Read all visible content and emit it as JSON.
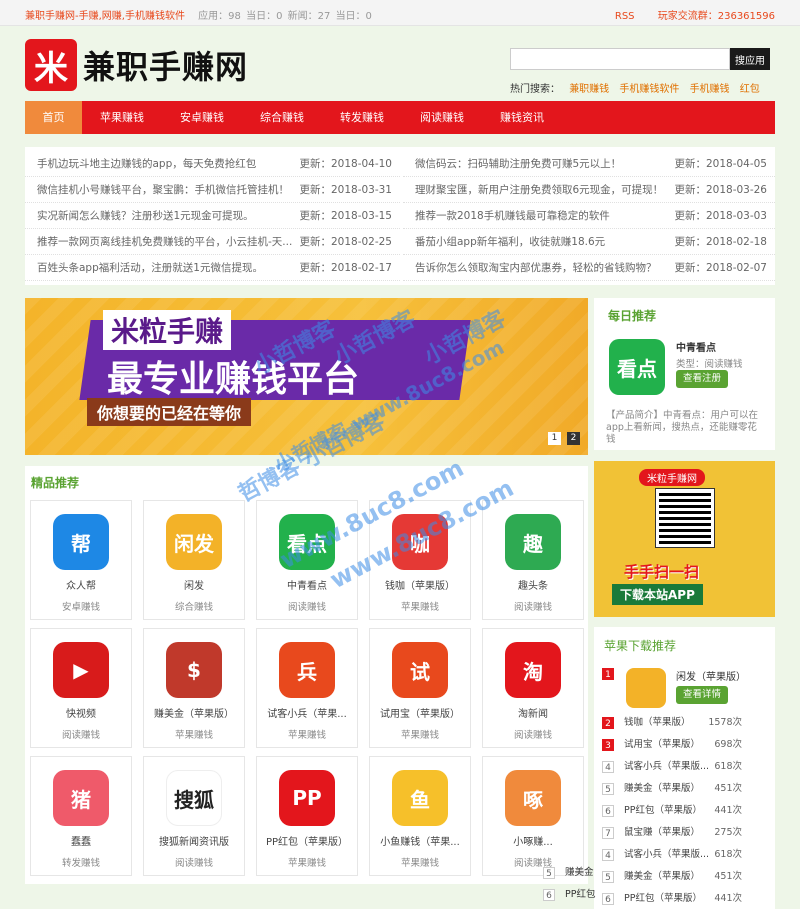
{
  "topbar": {
    "site": "兼职手赚网-手赚,网赚,手机赚钱软件",
    "stats": [
      "应用：98",
      "当日：0",
      "新闻：27",
      "当日：0"
    ],
    "rss": "RSS",
    "qq_group": "玩家交流群：236361596"
  },
  "header": {
    "logo_mark": "米",
    "logo_text": "兼职手赚网",
    "search": {
      "placeholder": "",
      "button": "搜应用"
    },
    "hot_label": "热门搜索：",
    "hot_keywords": [
      "兼职赚钱",
      "手机赚钱软件",
      "手机赚钱",
      "红包"
    ]
  },
  "nav": [
    "首页",
    "苹果赚钱",
    "安卓赚钱",
    "综合赚钱",
    "转发赚钱",
    "阅读赚钱",
    "赚钱资讯"
  ],
  "news": [
    {
      "title": "手机边玩斗地主边赚钱的app，每天免费抢红包",
      "date": "更新：2018-04-10"
    },
    {
      "title": "微信码云：扫码辅助注册免费可赚5元以上！",
      "date": "更新：2018-04-05"
    },
    {
      "title": "微信挂机小号赚钱平台，聚宝鹏：手机微信托管挂机！",
      "date": "更新：2018-03-31"
    },
    {
      "title": "理财聚宝匯，新用户注册免费领取6元现金，可提现！",
      "date": "更新：2018-03-26"
    },
    {
      "title": "实况新闻怎么赚钱？注册秒送1元现金可提现。",
      "date": "更新：2018-03-15"
    },
    {
      "title": "推荐一款2018手机赚钱最可靠稳定的软件",
      "date": "更新：2018-03-03"
    },
    {
      "title": "推荐一款网页离线挂机免费赚钱的平台，小云挂机-天...",
      "date": "更新：2018-02-25"
    },
    {
      "title": "番茄小组app新年福利，收徒就赚18.6元",
      "date": "更新：2018-02-18"
    },
    {
      "title": "百姓头条app福利活动，注册就送1元微信提现。",
      "date": "更新：2018-02-17"
    },
    {
      "title": "告诉你怎么领取淘宝内部优惠券，轻松的省钱购物？",
      "date": "更新：2018-02-07"
    }
  ],
  "banner": {
    "line1": "米粒手赚",
    "line2": "最专业赚钱平台",
    "line3": "你想要的已经在等你",
    "pages": [
      "1",
      "2"
    ],
    "active_page": "2"
  },
  "featured": {
    "title": "精品推荐",
    "apps": [
      {
        "name": "众人帮",
        "cat": "安卓赚钱",
        "glyph": "帮",
        "color": "#1e88e5"
      },
      {
        "name": "闲发",
        "cat": "综合赚钱",
        "glyph": "闲发",
        "color": "#f3b228"
      },
      {
        "name": "中青看点",
        "cat": "阅读赚钱",
        "glyph": "看点",
        "color": "#22b14c"
      },
      {
        "name": "钱咖（苹果版）",
        "cat": "苹果赚钱",
        "glyph": "咖",
        "color": "#e53935"
      },
      {
        "name": "趣头条",
        "cat": "阅读赚钱",
        "glyph": "趣",
        "color": "#2eaa52"
      },
      {
        "name": "快视频",
        "cat": "阅读赚钱",
        "glyph": "▶",
        "color": "#d81b1b"
      },
      {
        "name": "赚美金（苹果版）",
        "cat": "苹果赚钱",
        "glyph": "$",
        "color": "#c0392b"
      },
      {
        "name": "试客小兵（苹果...",
        "cat": "苹果赚钱",
        "glyph": "兵",
        "color": "#e8491d"
      },
      {
        "name": "试用宝（苹果版）",
        "cat": "苹果赚钱",
        "glyph": "试",
        "color": "#e8491d"
      },
      {
        "name": "淘新闻",
        "cat": "阅读赚钱",
        "glyph": "淘",
        "color": "#e3161c"
      },
      {
        "name": "蠢蠢",
        "cat": "转发赚钱",
        "glyph": "猪",
        "color": "#ef5a6a"
      },
      {
        "name": "搜狐新闻资讯版",
        "cat": "阅读赚钱",
        "glyph": "搜狐",
        "color": "#ffffff"
      },
      {
        "name": "PP红包（苹果版）",
        "cat": "苹果赚钱",
        "glyph": "PP",
        "color": "#e3161c"
      },
      {
        "name": "小鱼赚钱（苹果...",
        "cat": "苹果赚钱",
        "glyph": "鱼",
        "color": "#f6c02a"
      },
      {
        "name": "小啄赚...",
        "cat": "阅读赚钱",
        "glyph": "啄",
        "color": "#f08a3c"
      }
    ]
  },
  "daily": {
    "title": "每日推荐",
    "app_name": "中青看点",
    "app_icon": "看点",
    "app_type": "类型：阅读赚钱",
    "button": "查看注册",
    "desc": "【产品简介】中青看点：用户可以在app上看新闻，搜热点，还能赚零花钱"
  },
  "qr_ad": {
    "header": "米粒手赚网",
    "line1": "手手扫一扫",
    "line2": "下载本站APP"
  },
  "apple": {
    "title": "苹果下载推荐",
    "first": {
      "rank": "1",
      "name": "闲发（苹果版）",
      "button": "查看详情"
    },
    "list": [
      {
        "rank": "2",
        "name": "钱咖（苹果版）",
        "count": "1578次"
      },
      {
        "rank": "3",
        "name": "试用宝（苹果版）",
        "count": "698次"
      },
      {
        "rank": "4",
        "name": "试客小兵（苹果版...",
        "count": "618次"
      },
      {
        "rank": "5",
        "name": "赚美金（苹果版）",
        "count": "451次"
      },
      {
        "rank": "6",
        "name": "PP红包（苹果版）",
        "count": "441次"
      },
      {
        "rank": "7",
        "name": "鼠宝赚（苹果版）",
        "count": "275次"
      },
      {
        "rank": "4",
        "name": "试客小兵（苹果版...",
        "count": "618次"
      },
      {
        "rank": "5",
        "name": "赚美金（苹果版）",
        "count": "451次"
      },
      {
        "rank": "6",
        "name": "PP红包（苹果版）",
        "count": "441次"
      }
    ]
  },
  "overflow_list": [
    {
      "rank": "5",
      "name": "赚美金"
    },
    {
      "rank": "6",
      "name": "PP红包"
    }
  ],
  "watermarks": [
    "小哲博客",
    "小哲博客",
    "小哲博客",
    "小哲博客 www.8uc8.com",
    "哲博客 小哲博客",
    "www.8uc8.com",
    "www.8uc8.com"
  ]
}
